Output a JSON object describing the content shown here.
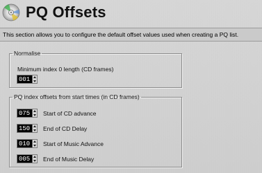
{
  "page": {
    "title": "PQ Offsets",
    "icon": "cd-disc-icon",
    "description": "This section allows you to configure the default offset values used when creating a PQ list."
  },
  "normalise": {
    "legend": "Normalise",
    "min_index_label": "Minimum index 0 length (CD frames)",
    "min_index_value": "001"
  },
  "pq_offsets": {
    "legend": "PQ index offsets from start times (in CD frames)",
    "rows": [
      {
        "value": "075",
        "label": "Start of CD advance"
      },
      {
        "value": "150",
        "label": "End of CD Delay"
      },
      {
        "value": "010",
        "label": "Start of Music Advance"
      },
      {
        "value": "005",
        "label": "End of Music Delay"
      }
    ]
  },
  "colors": {
    "background": "#d0d0d0",
    "spin_background": "#000000",
    "spin_text": "#ffffff"
  }
}
